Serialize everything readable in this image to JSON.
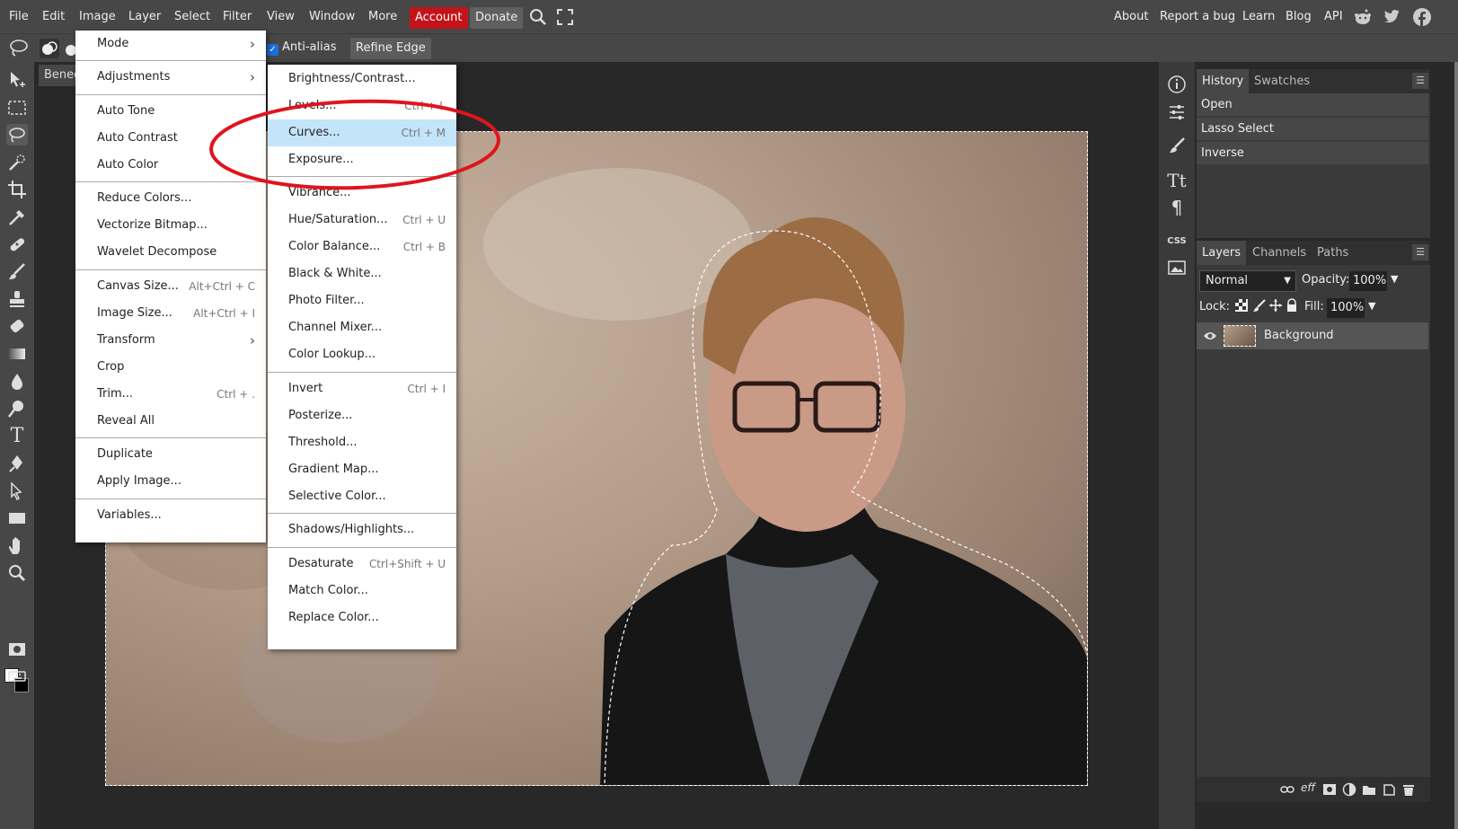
{
  "menubar": {
    "items": [
      "File",
      "Edit",
      "Image",
      "Layer",
      "Select",
      "Filter",
      "View",
      "Window",
      "More"
    ],
    "account": "Account",
    "donate": "Donate",
    "links": [
      "About",
      "Report a bug",
      "Learn",
      "Blog",
      "API"
    ],
    "colors": {
      "account": "#c4141a",
      "bar": "#474747"
    }
  },
  "options": {
    "antialias_label": "Anti-alias",
    "antialias_checked": true,
    "refine_edge": "Refine Edge"
  },
  "doc_tab": {
    "title": "Bened"
  },
  "image_menu": {
    "items": [
      {
        "label": "Mode",
        "submenu": true
      },
      {
        "label": "Adjustments",
        "submenu": true
      },
      {
        "label": "Auto Tone"
      },
      {
        "label": "Auto Contrast"
      },
      {
        "label": "Auto Color"
      },
      {
        "label": "Reduce Colors..."
      },
      {
        "label": "Vectorize Bitmap..."
      },
      {
        "label": "Wavelet Decompose"
      },
      {
        "label": "Canvas Size...",
        "shortcut": "Alt+Ctrl + C"
      },
      {
        "label": "Image Size...",
        "shortcut": "Alt+Ctrl + I"
      },
      {
        "label": "Transform",
        "submenu": true
      },
      {
        "label": "Crop"
      },
      {
        "label": "Trim...",
        "shortcut": "Ctrl + ."
      },
      {
        "label": "Reveal All"
      },
      {
        "label": "Duplicate"
      },
      {
        "label": "Apply Image..."
      },
      {
        "label": "Variables..."
      }
    ]
  },
  "adjustments_menu": {
    "items": [
      {
        "label": "Brightness/Contrast..."
      },
      {
        "label": "Levels...",
        "shortcut": "Ctrl + L"
      },
      {
        "label": "Curves...",
        "shortcut": "Ctrl + M",
        "highlighted": true
      },
      {
        "label": "Exposure..."
      },
      {
        "label": "Vibrance..."
      },
      {
        "label": "Hue/Saturation...",
        "shortcut": "Ctrl + U"
      },
      {
        "label": "Color Balance...",
        "shortcut": "Ctrl + B"
      },
      {
        "label": "Black & White..."
      },
      {
        "label": "Photo Filter..."
      },
      {
        "label": "Channel Mixer..."
      },
      {
        "label": "Color Lookup..."
      },
      {
        "label": "Invert",
        "shortcut": "Ctrl + I"
      },
      {
        "label": "Posterize..."
      },
      {
        "label": "Threshold..."
      },
      {
        "label": "Gradient Map..."
      },
      {
        "label": "Selective Color..."
      },
      {
        "label": "Shadows/Highlights..."
      },
      {
        "label": "Desaturate",
        "shortcut": "Ctrl+Shift + U"
      },
      {
        "label": "Match Color..."
      },
      {
        "label": "Replace Color..."
      }
    ],
    "highlight_color": "#c4e4fa",
    "annotation_color": "#e0141e"
  },
  "history": {
    "tabs": [
      "History",
      "Swatches"
    ],
    "entries": [
      "Open",
      "Lasso Select",
      "Inverse"
    ]
  },
  "layers": {
    "tabs": [
      "Layers",
      "Channels",
      "Paths"
    ],
    "blend_mode": "Normal",
    "opacity_label": "Opacity:",
    "opacity": "100%",
    "lock_label": "Lock:",
    "fill_label": "Fill:",
    "fill": "100%",
    "layer_name": "Background",
    "footer_eff": "eff"
  },
  "side_panel": {
    "css_label": "CSS"
  }
}
